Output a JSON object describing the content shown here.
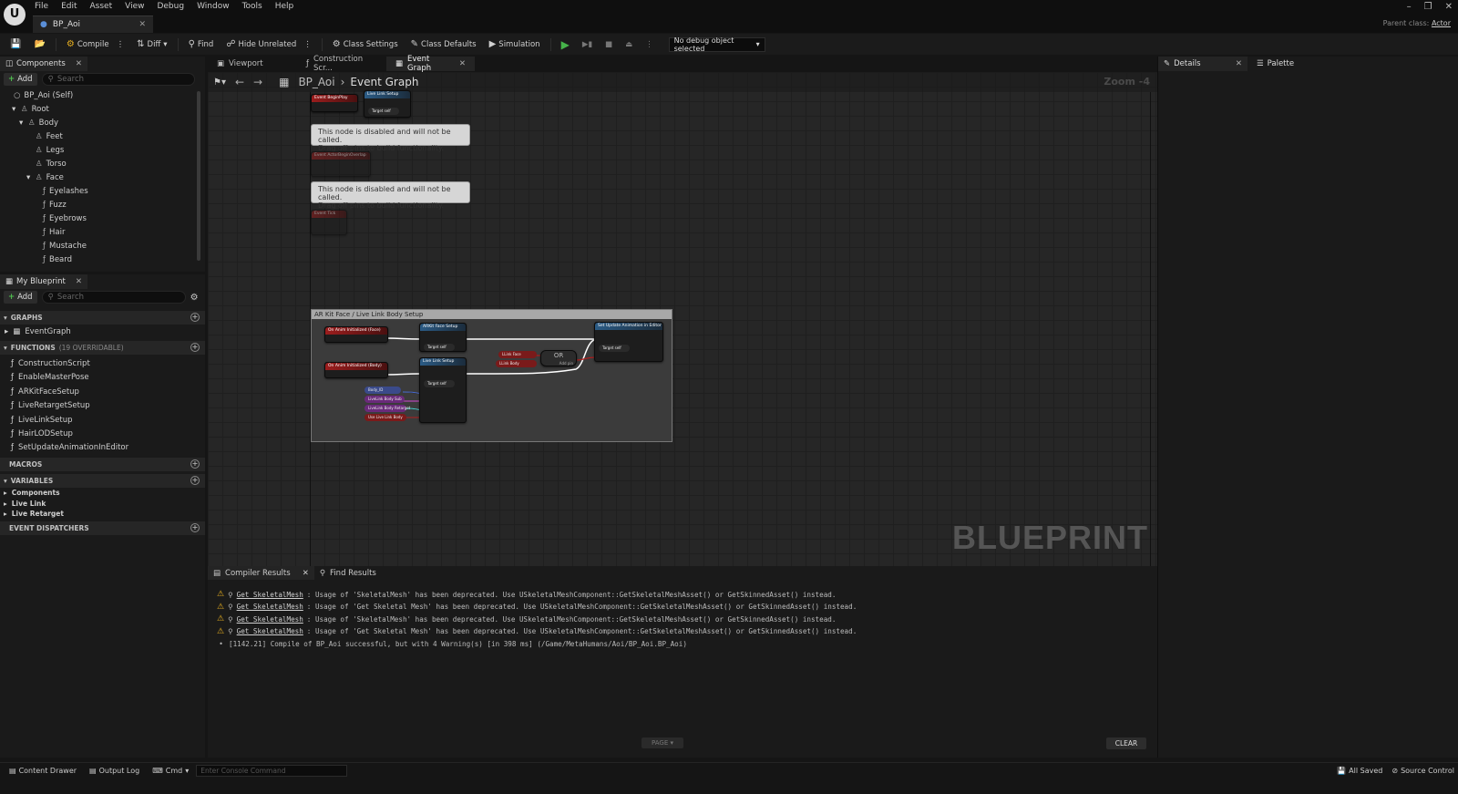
{
  "app": {
    "menu": [
      "File",
      "Edit",
      "Asset",
      "View",
      "Debug",
      "Window",
      "Tools",
      "Help"
    ],
    "document_tab": "BP_Aoi",
    "parent_class_label": "Parent class:",
    "parent_class_value": "Actor"
  },
  "toolbar": {
    "compile": "Compile",
    "diff": "Diff",
    "find": "Find",
    "hide_unrelated": "Hide Unrelated",
    "class_settings": "Class Settings",
    "class_defaults": "Class Defaults",
    "simulation": "Simulation",
    "debug_object": "No debug object selected"
  },
  "components": {
    "tab": "Components",
    "add": "Add",
    "search_placeholder": "Search",
    "tree": [
      {
        "label": "BP_Aoi (Self)",
        "depth": 0,
        "icon": "actor-icon"
      },
      {
        "label": "Root",
        "depth": 1,
        "icon": "scene-icon"
      },
      {
        "label": "Body",
        "depth": 2,
        "icon": "skeletal-mesh-icon"
      },
      {
        "label": "Feet",
        "depth": 3,
        "icon": "skeletal-mesh-icon"
      },
      {
        "label": "Legs",
        "depth": 3,
        "icon": "skeletal-mesh-icon"
      },
      {
        "label": "Torso",
        "depth": 3,
        "icon": "skeletal-mesh-icon"
      },
      {
        "label": "Face",
        "depth": 3,
        "icon": "skeletal-mesh-icon"
      },
      {
        "label": "Eyelashes",
        "depth": 4,
        "icon": "groom-icon"
      },
      {
        "label": "Fuzz",
        "depth": 4,
        "icon": "groom-icon"
      },
      {
        "label": "Eyebrows",
        "depth": 4,
        "icon": "groom-icon"
      },
      {
        "label": "Hair",
        "depth": 4,
        "icon": "groom-icon"
      },
      {
        "label": "Mustache",
        "depth": 4,
        "icon": "groom-icon"
      },
      {
        "label": "Beard",
        "depth": 4,
        "icon": "groom-icon"
      }
    ]
  },
  "my_blueprint": {
    "tab": "My Blueprint",
    "add": "Add",
    "search_placeholder": "Search",
    "graphs_header": "GRAPHS",
    "graph_item": "EventGraph",
    "functions_header": "FUNCTIONS",
    "functions_count": "(19 OVERRIDABLE)",
    "functions": [
      "ConstructionScript",
      "EnableMasterPose",
      "ARKitFaceSetup",
      "LiveRetargetSetup",
      "LiveLinkSetup",
      "HairLODSetup",
      "SetUpdateAnimationInEditor"
    ],
    "macros_header": "MACROS",
    "variables_header": "VARIABLES",
    "variable_groups": [
      "Components",
      "Live Link",
      "Live Retarget"
    ],
    "dispatchers_header": "EVENT DISPATCHERS"
  },
  "graph_tabs": [
    {
      "label": "Viewport",
      "active": false
    },
    {
      "label": "Construction Scr...",
      "active": false
    },
    {
      "label": "Event Graph",
      "active": true
    }
  ],
  "graph": {
    "breadcrumb_root": "BP_Aoi",
    "breadcrumb_leaf": "Event Graph",
    "zoom": "Zoom -4",
    "watermark": "BLUEPRINT",
    "disabled_note_line1": "This node is disabled and will not be called.",
    "disabled_note_line2": "Drag off pins to build functionality.",
    "comment_title": "AR Kit Face / Live Link Body Setup",
    "nodes": {
      "begin_play": "Event BeginPlay",
      "live_link_setup_top": "Live Link Setup",
      "actor_overlap": "Event ActorBeginOverlap",
      "event_tick": "Event Tick",
      "face_init": "On Anim Initialized (Face)",
      "body_init": "On Anim Initialized (Body)",
      "arkit_setup": "ARKit Face Setup",
      "livelink_setup": "Live Link Setup",
      "update_anim": "Set Update Animation in Editor",
      "or_node": "OR",
      "target_self": "Target self",
      "add_pin": "Add pin",
      "body_id": "Body_ID",
      "llink_body_sub": "LiveLink Body Sub",
      "llink_body_retarget": "LiveLink Body Retarget",
      "use_llink_body": "Use Live Link Body",
      "llink_face": "LLink Face",
      "llink_body": "LLink Body"
    }
  },
  "bottom_tabs": [
    {
      "label": "Compiler Results",
      "active": true
    },
    {
      "label": "Find Results",
      "active": false
    }
  ],
  "results": {
    "messages": [
      {
        "link": "Get_SkeletalMesh",
        "text": ": Usage of 'SkeletalMesh' has been deprecated. Use USkeletalMeshComponent::GetSkeletalMeshAsset() or GetSkinnedAsset() instead."
      },
      {
        "link": "Get_SkeletalMesh",
        "text": ": Usage of 'Get Skeletal Mesh' has been deprecated. Use USkeletalMeshComponent::GetSkeletalMeshAsset() or GetSkinnedAsset() instead."
      },
      {
        "link": "Get_SkeletalMesh",
        "text": ": Usage of 'SkeletalMesh' has been deprecated. Use USkeletalMeshComponent::GetSkeletalMeshAsset() or GetSkinnedAsset() instead."
      },
      {
        "link": "Get_SkeletalMesh",
        "text": ": Usage of 'Get Skeletal Mesh' has been deprecated. Use USkeletalMeshComponent::GetSkeletalMeshAsset() or GetSkinnedAsset() instead."
      }
    ],
    "summary": "[1142.21] Compile of BP_Aoi successful, but with 4 Warning(s) [in 398 ms] (/Game/MetaHumans/Aoi/BP_Aoi.BP_Aoi)",
    "page": "PAGE",
    "clear": "CLEAR"
  },
  "right_panels": {
    "details": "Details",
    "palette": "Palette"
  },
  "status_bar": {
    "content_drawer": "Content Drawer",
    "output_log": "Output Log",
    "cmd": "Cmd",
    "console_placeholder": "Enter Console Command",
    "all_saved": "All Saved",
    "source_control": "Source Control"
  },
  "colors": {
    "accent_green": "#46b34a",
    "warning": "#e8b020",
    "event_red": "#9c1d1d",
    "function_blue": "#2b5b85"
  }
}
